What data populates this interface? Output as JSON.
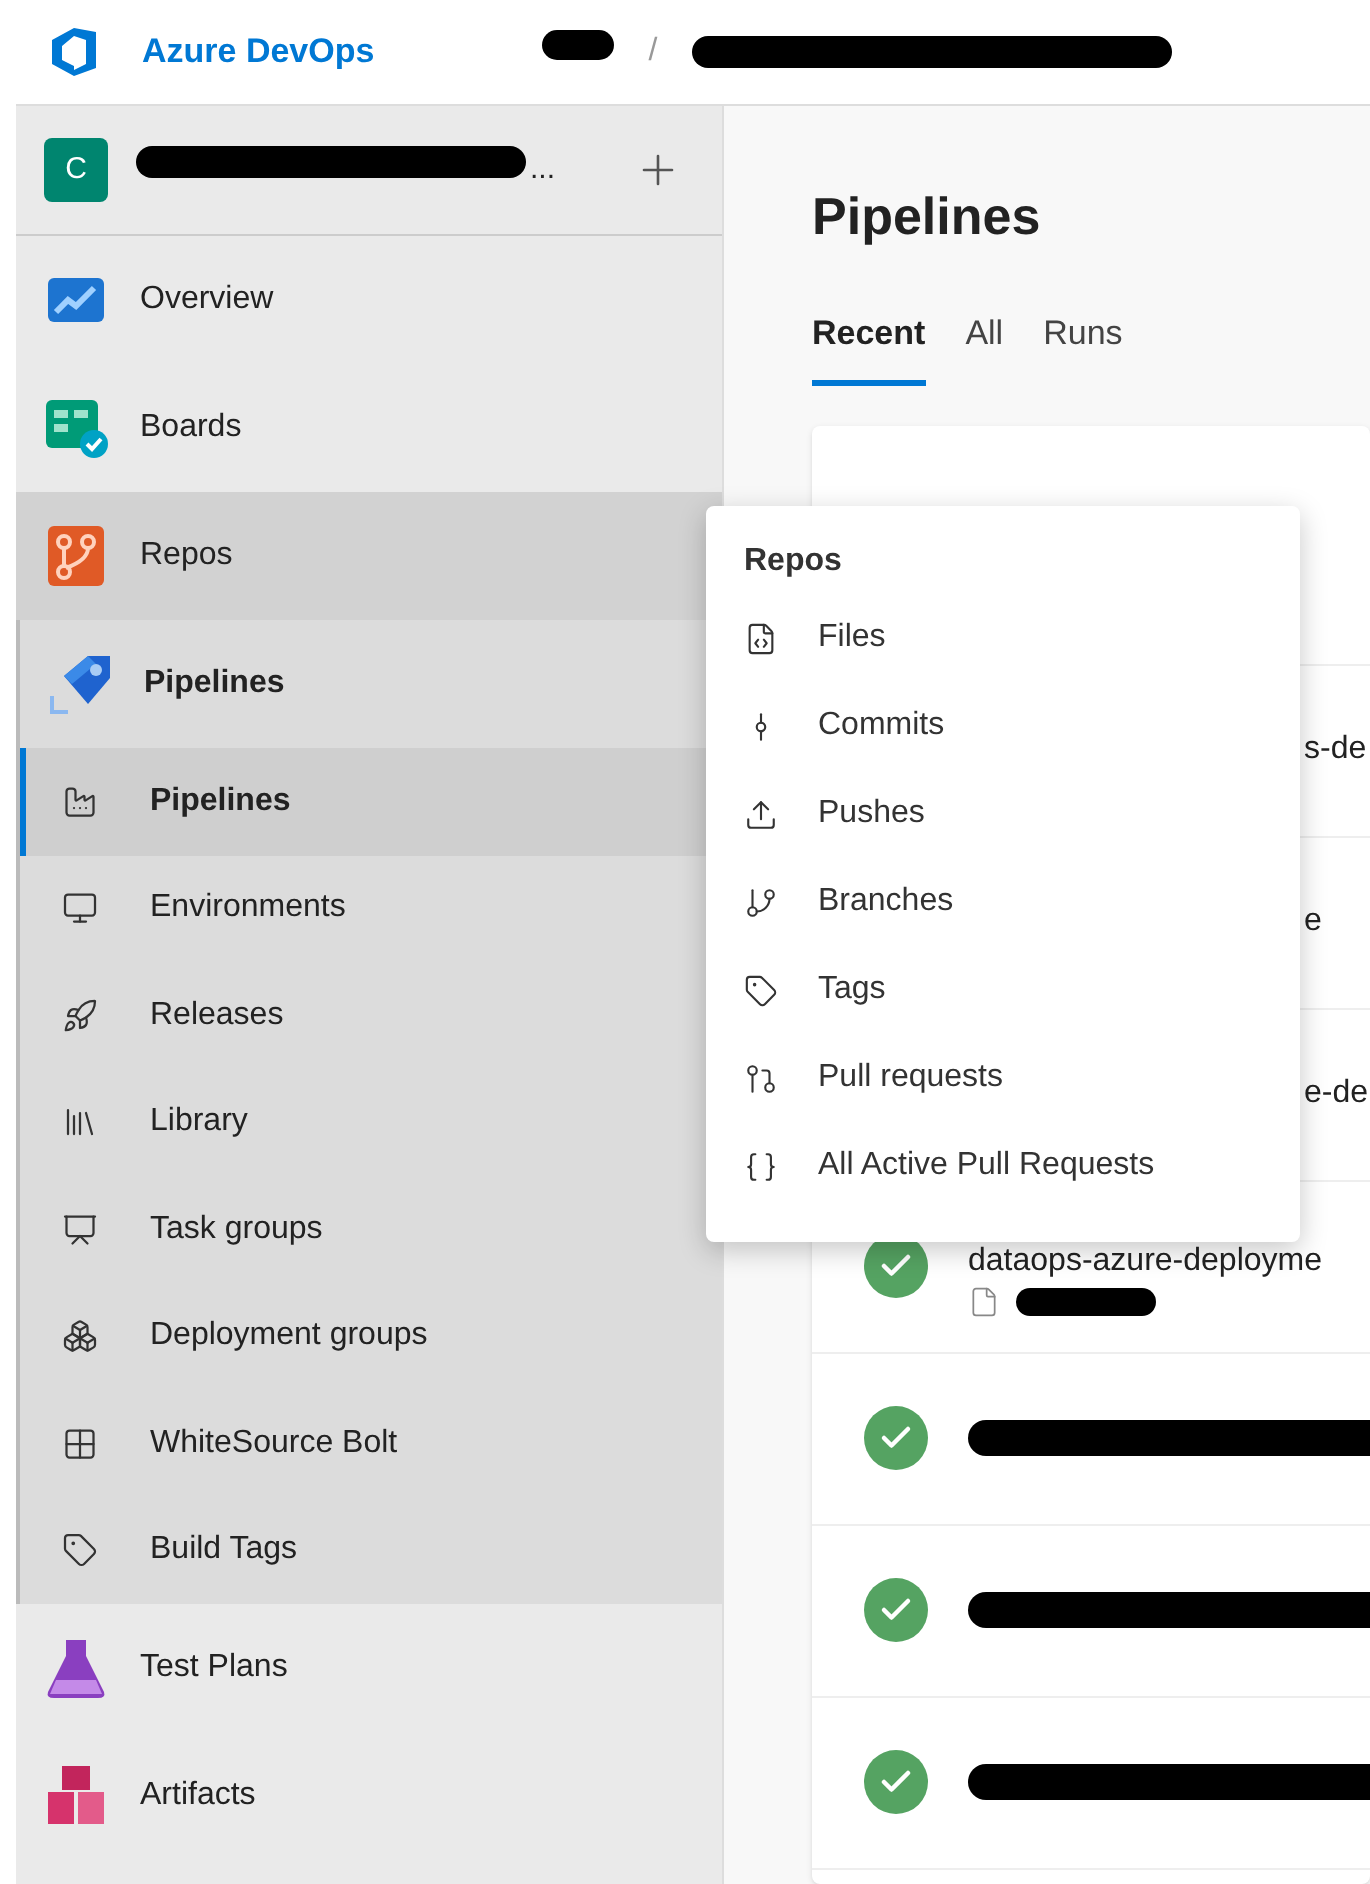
{
  "header": {
    "brand": "Azure DevOps",
    "separator": "/"
  },
  "project": {
    "avatar": "C",
    "name_tail": "..."
  },
  "nav": [
    {
      "label": "Overview",
      "hovered": false,
      "expanded": false
    },
    {
      "label": "Boards",
      "hovered": false,
      "expanded": false
    },
    {
      "label": "Repos",
      "hovered": true,
      "expanded": false
    },
    {
      "label": "Pipelines",
      "hovered": false,
      "expanded": true,
      "children": [
        {
          "label": "Pipelines",
          "selected": true
        },
        {
          "label": "Environments",
          "selected": false
        },
        {
          "label": "Releases",
          "selected": false
        },
        {
          "label": "Library",
          "selected": false
        },
        {
          "label": "Task groups",
          "selected": false
        },
        {
          "label": "Deployment groups",
          "selected": false
        },
        {
          "label": "WhiteSource Bolt",
          "selected": false
        },
        {
          "label": "Build Tags",
          "selected": false
        }
      ]
    },
    {
      "label": "Test Plans",
      "hovered": false,
      "expanded": false
    },
    {
      "label": "Artifacts",
      "hovered": false,
      "expanded": false
    }
  ],
  "page": {
    "title": "Pipelines",
    "tabs": [
      {
        "label": "Recent",
        "selected": true
      },
      {
        "label": "All",
        "selected": false
      },
      {
        "label": "Runs",
        "selected": false
      }
    ]
  },
  "rows": [
    {
      "kind": "partial",
      "name": "s-de"
    },
    {
      "kind": "partial",
      "name": "e"
    },
    {
      "kind": "partial",
      "name": "e-de"
    },
    {
      "kind": "full",
      "name": "dataops-azure-deployme"
    },
    {
      "kind": "redacted"
    },
    {
      "kind": "redacted"
    },
    {
      "kind": "redacted"
    }
  ],
  "flyout": {
    "title": "Repos",
    "items": [
      {
        "label": "Files"
      },
      {
        "label": "Commits"
      },
      {
        "label": "Pushes"
      },
      {
        "label": "Branches"
      },
      {
        "label": "Tags"
      },
      {
        "label": "Pull requests"
      },
      {
        "label": "All Active Pull Requests"
      }
    ]
  }
}
